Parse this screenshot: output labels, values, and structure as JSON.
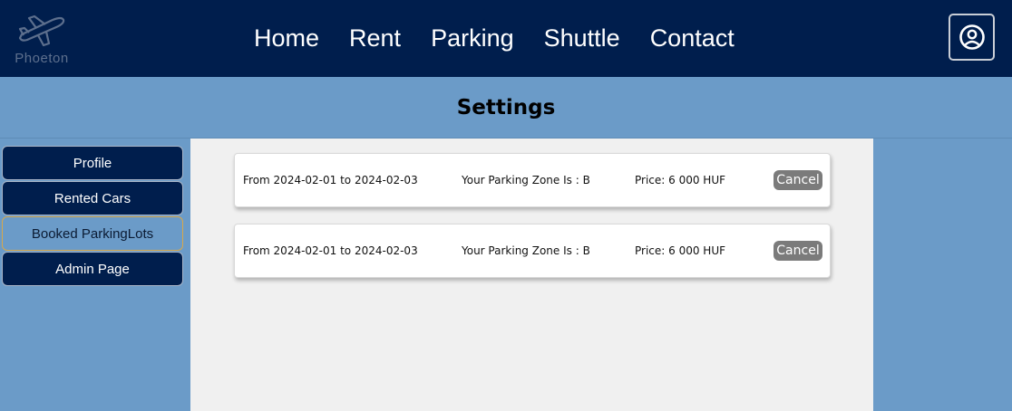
{
  "brand": {
    "name": "Phoeton",
    "logo_icon": "airplane-icon"
  },
  "nav": {
    "items": [
      "Home",
      "Rent",
      "Parking",
      "Shuttle",
      "Contact"
    ]
  },
  "user_button": {
    "icon": "user-circle-icon"
  },
  "page": {
    "title": "Settings"
  },
  "sidebar": {
    "items": [
      {
        "label": "Profile"
      },
      {
        "label": "Rented Cars"
      },
      {
        "label": "Booked ParkingLots",
        "active": true
      },
      {
        "label": "Admin Page"
      }
    ]
  },
  "bookings": [
    {
      "dates": "From 2024-02-01 to 2024-02-03",
      "zone": "Your Parking Zone Is : B",
      "price": "Price: 6 000 HUF",
      "cancel_label": "Cancel"
    },
    {
      "dates": "From 2024-02-01 to 2024-02-03",
      "zone": "Your Parking Zone Is : B",
      "price": "Price: 6 000 HUF",
      "cancel_label": "Cancel"
    }
  ],
  "colors": {
    "navbar": "#001e4d",
    "page_bg": "#6b9bc8",
    "content_bg": "#f0f0f0",
    "active_border": "#d8a84a",
    "cancel_button": "#7b7b7b"
  }
}
